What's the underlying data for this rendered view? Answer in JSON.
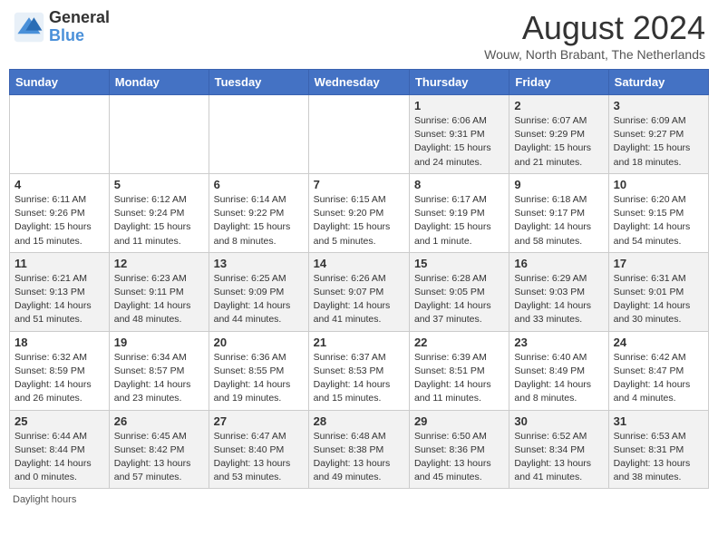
{
  "header": {
    "logo_line1": "General",
    "logo_line2": "Blue",
    "month_title": "August 2024",
    "location": "Wouw, North Brabant, The Netherlands"
  },
  "columns": [
    "Sunday",
    "Monday",
    "Tuesday",
    "Wednesday",
    "Thursday",
    "Friday",
    "Saturday"
  ],
  "weeks": [
    [
      {
        "day": "",
        "info": ""
      },
      {
        "day": "",
        "info": ""
      },
      {
        "day": "",
        "info": ""
      },
      {
        "day": "",
        "info": ""
      },
      {
        "day": "1",
        "info": "Sunrise: 6:06 AM\nSunset: 9:31 PM\nDaylight: 15 hours and 24 minutes."
      },
      {
        "day": "2",
        "info": "Sunrise: 6:07 AM\nSunset: 9:29 PM\nDaylight: 15 hours and 21 minutes."
      },
      {
        "day": "3",
        "info": "Sunrise: 6:09 AM\nSunset: 9:27 PM\nDaylight: 15 hours and 18 minutes."
      }
    ],
    [
      {
        "day": "4",
        "info": "Sunrise: 6:11 AM\nSunset: 9:26 PM\nDaylight: 15 hours and 15 minutes."
      },
      {
        "day": "5",
        "info": "Sunrise: 6:12 AM\nSunset: 9:24 PM\nDaylight: 15 hours and 11 minutes."
      },
      {
        "day": "6",
        "info": "Sunrise: 6:14 AM\nSunset: 9:22 PM\nDaylight: 15 hours and 8 minutes."
      },
      {
        "day": "7",
        "info": "Sunrise: 6:15 AM\nSunset: 9:20 PM\nDaylight: 15 hours and 5 minutes."
      },
      {
        "day": "8",
        "info": "Sunrise: 6:17 AM\nSunset: 9:19 PM\nDaylight: 15 hours and 1 minute."
      },
      {
        "day": "9",
        "info": "Sunrise: 6:18 AM\nSunset: 9:17 PM\nDaylight: 14 hours and 58 minutes."
      },
      {
        "day": "10",
        "info": "Sunrise: 6:20 AM\nSunset: 9:15 PM\nDaylight: 14 hours and 54 minutes."
      }
    ],
    [
      {
        "day": "11",
        "info": "Sunrise: 6:21 AM\nSunset: 9:13 PM\nDaylight: 14 hours and 51 minutes."
      },
      {
        "day": "12",
        "info": "Sunrise: 6:23 AM\nSunset: 9:11 PM\nDaylight: 14 hours and 48 minutes."
      },
      {
        "day": "13",
        "info": "Sunrise: 6:25 AM\nSunset: 9:09 PM\nDaylight: 14 hours and 44 minutes."
      },
      {
        "day": "14",
        "info": "Sunrise: 6:26 AM\nSunset: 9:07 PM\nDaylight: 14 hours and 41 minutes."
      },
      {
        "day": "15",
        "info": "Sunrise: 6:28 AM\nSunset: 9:05 PM\nDaylight: 14 hours and 37 minutes."
      },
      {
        "day": "16",
        "info": "Sunrise: 6:29 AM\nSunset: 9:03 PM\nDaylight: 14 hours and 33 minutes."
      },
      {
        "day": "17",
        "info": "Sunrise: 6:31 AM\nSunset: 9:01 PM\nDaylight: 14 hours and 30 minutes."
      }
    ],
    [
      {
        "day": "18",
        "info": "Sunrise: 6:32 AM\nSunset: 8:59 PM\nDaylight: 14 hours and 26 minutes."
      },
      {
        "day": "19",
        "info": "Sunrise: 6:34 AM\nSunset: 8:57 PM\nDaylight: 14 hours and 23 minutes."
      },
      {
        "day": "20",
        "info": "Sunrise: 6:36 AM\nSunset: 8:55 PM\nDaylight: 14 hours and 19 minutes."
      },
      {
        "day": "21",
        "info": "Sunrise: 6:37 AM\nSunset: 8:53 PM\nDaylight: 14 hours and 15 minutes."
      },
      {
        "day": "22",
        "info": "Sunrise: 6:39 AM\nSunset: 8:51 PM\nDaylight: 14 hours and 11 minutes."
      },
      {
        "day": "23",
        "info": "Sunrise: 6:40 AM\nSunset: 8:49 PM\nDaylight: 14 hours and 8 minutes."
      },
      {
        "day": "24",
        "info": "Sunrise: 6:42 AM\nSunset: 8:47 PM\nDaylight: 14 hours and 4 minutes."
      }
    ],
    [
      {
        "day": "25",
        "info": "Sunrise: 6:44 AM\nSunset: 8:44 PM\nDaylight: 14 hours and 0 minutes."
      },
      {
        "day": "26",
        "info": "Sunrise: 6:45 AM\nSunset: 8:42 PM\nDaylight: 13 hours and 57 minutes."
      },
      {
        "day": "27",
        "info": "Sunrise: 6:47 AM\nSunset: 8:40 PM\nDaylight: 13 hours and 53 minutes."
      },
      {
        "day": "28",
        "info": "Sunrise: 6:48 AM\nSunset: 8:38 PM\nDaylight: 13 hours and 49 minutes."
      },
      {
        "day": "29",
        "info": "Sunrise: 6:50 AM\nSunset: 8:36 PM\nDaylight: 13 hours and 45 minutes."
      },
      {
        "day": "30",
        "info": "Sunrise: 6:52 AM\nSunset: 8:34 PM\nDaylight: 13 hours and 41 minutes."
      },
      {
        "day": "31",
        "info": "Sunrise: 6:53 AM\nSunset: 8:31 PM\nDaylight: 13 hours and 38 minutes."
      }
    ]
  ],
  "footer": "Daylight hours"
}
